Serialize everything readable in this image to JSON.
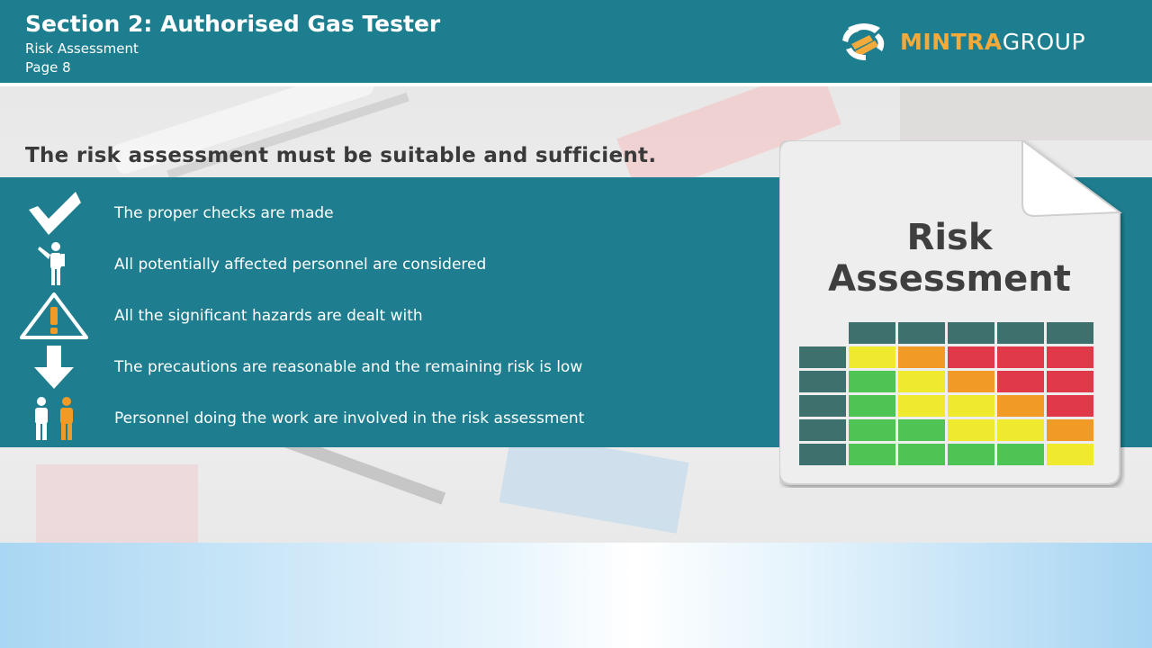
{
  "header": {
    "title": "Section 2: Authorised Gas Tester",
    "subtitle": "Risk Assessment",
    "page": "Page 8",
    "logo_part1": "MINTRA",
    "logo_part2": "GROUP"
  },
  "headline": "The risk assessment must be suitable and sufficient.",
  "items": [
    {
      "icon": "checkmark-icon",
      "text": "The proper checks are made"
    },
    {
      "icon": "person-pointing-icon",
      "text": "All potentially affected personnel are considered"
    },
    {
      "icon": "warning-icon",
      "text": "All the significant hazards are dealt with"
    },
    {
      "icon": "down-arrow-icon",
      "text": "The precautions are reasonable and the remaining risk is low"
    },
    {
      "icon": "two-people-icon",
      "text": "Personnel doing the work are involved in the risk assessment"
    }
  ],
  "document": {
    "title_line1": "Risk",
    "title_line2": "Assessment",
    "matrix_colors": [
      [
        "#f0ea2e",
        "#f29a26",
        "#e0394a",
        "#e0394a",
        "#e0394a"
      ],
      [
        "#4ec455",
        "#f0ea2e",
        "#f29a26",
        "#e0394a",
        "#e0394a"
      ],
      [
        "#4ec455",
        "#f0ea2e",
        "#f0ea2e",
        "#f29a26",
        "#e0394a"
      ],
      [
        "#4ec455",
        "#4ec455",
        "#f0ea2e",
        "#f0ea2e",
        "#f29a26"
      ],
      [
        "#4ec455",
        "#4ec455",
        "#4ec455",
        "#4ec455",
        "#f0ea2e"
      ]
    ]
  },
  "colors": {
    "teal": "#1c7e8e",
    "accent": "#f4a93b",
    "matrix_header": "#3e706e"
  }
}
